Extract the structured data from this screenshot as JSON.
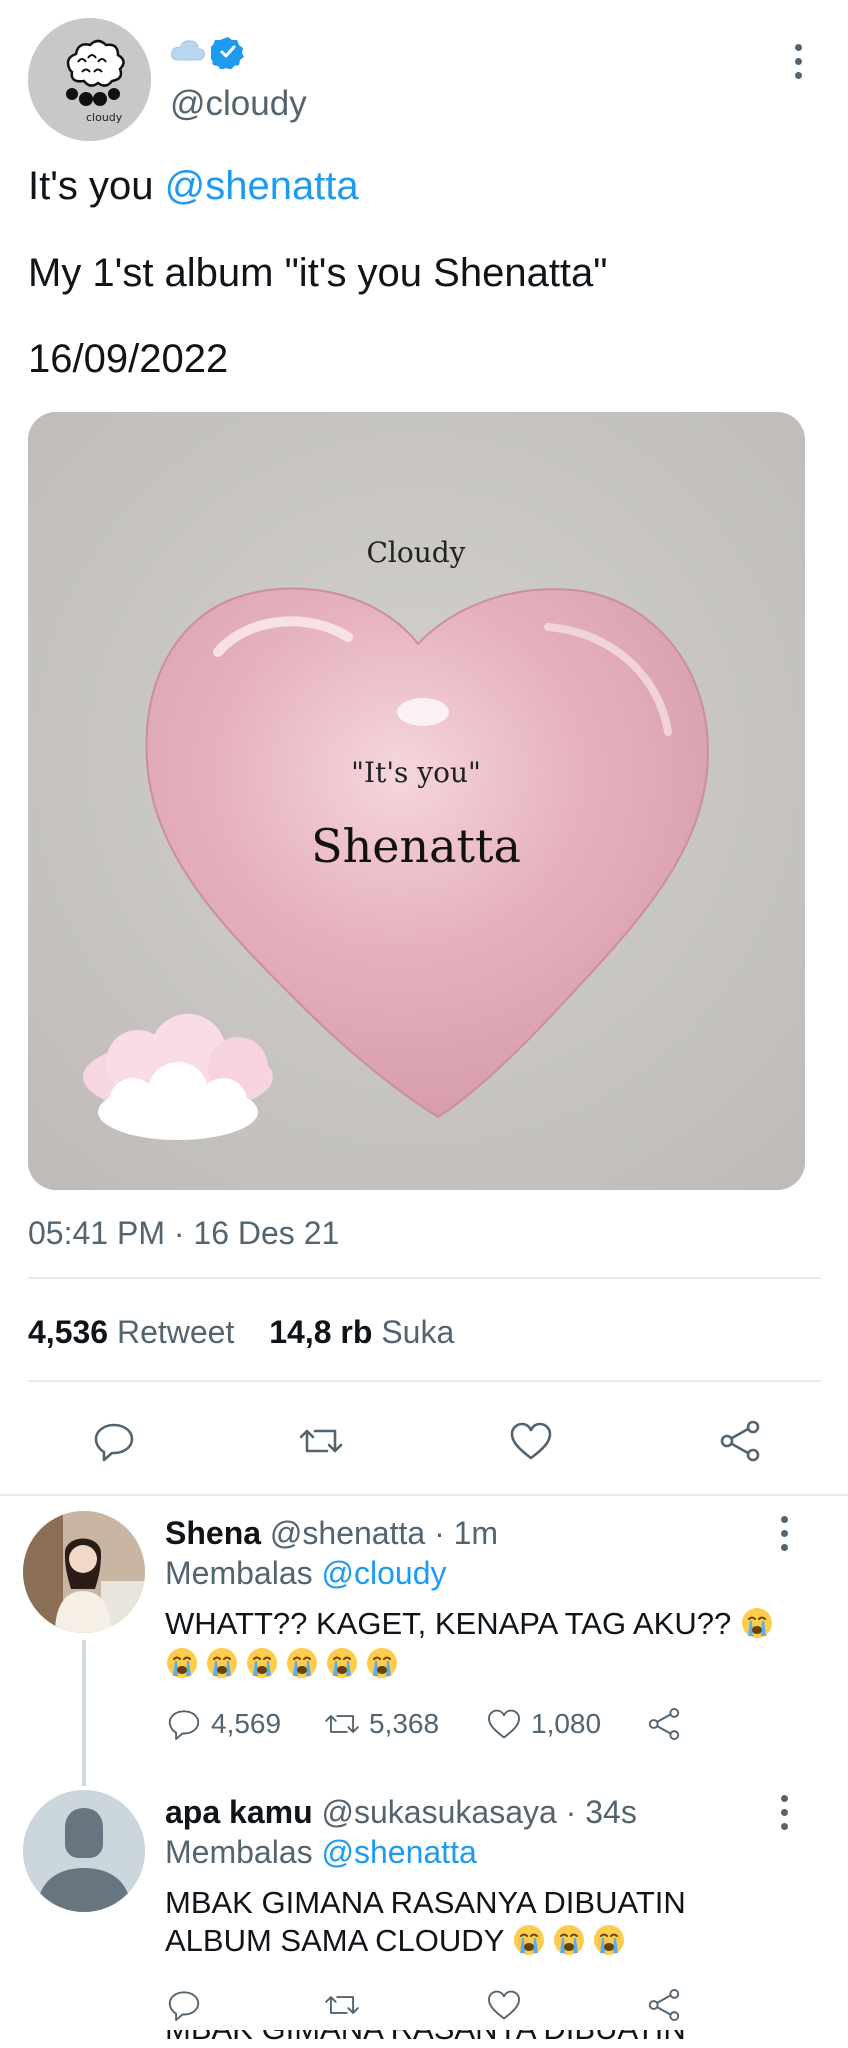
{
  "tweet": {
    "badge_emoji": "☁",
    "handle": "@cloudy",
    "line1_text": "It's you ",
    "line1_mention": "@shenatta",
    "line2": "My 1'st album \"it's you Shenatta\"",
    "line3": "16/09/2022",
    "media": {
      "top_text": "Cloudy",
      "quote_text": "\"It's you\"",
      "name_text": "Shenatta"
    },
    "avatar_label": "cloudy",
    "timestamp": "05:41 PM · 16 Des 21",
    "retweet_count": "4,536",
    "retweet_label": "Retweet",
    "like_count": "14,8 rb",
    "like_label": "Suka"
  },
  "replies": [
    {
      "name": "Shena",
      "handle": "@shenatta",
      "time": " · 1m",
      "replying_label": "Membalas ",
      "replying_to": "@cloudy",
      "text_line1": "WHATT?? KAGET, KENAPA TAG AKU?? ",
      "emoji_count_line1": 1,
      "emoji_count_line2": 6,
      "reply_count": "4,569",
      "retweet_count": "5,368",
      "like_count": "1,080"
    },
    {
      "name": "apa kamu",
      "handle": "@sukasukasaya",
      "time": " · 34s",
      "replying_label": "Membalas ",
      "replying_to": "@shenatta",
      "text_line1": "MBAK GIMANA RASANYA DIBUATIN",
      "text_line2": "ALBUM SAMA CLOUDY ",
      "emoji_count_line2": 3
    }
  ],
  "cut_off_text": "MBAK GIMANA RASANYA DIBUATIN",
  "colors": {
    "link": "#1d9bf0",
    "muted": "#536471",
    "heart_pink": "#e9b7c2",
    "divider": "#e6ecf0"
  },
  "icons": [
    "cloud-icon",
    "verified-badge-icon",
    "more-icon",
    "reply-icon",
    "retweet-icon",
    "like-icon",
    "share-icon",
    "crying-emoji-icon",
    "default-avatar-icon"
  ]
}
